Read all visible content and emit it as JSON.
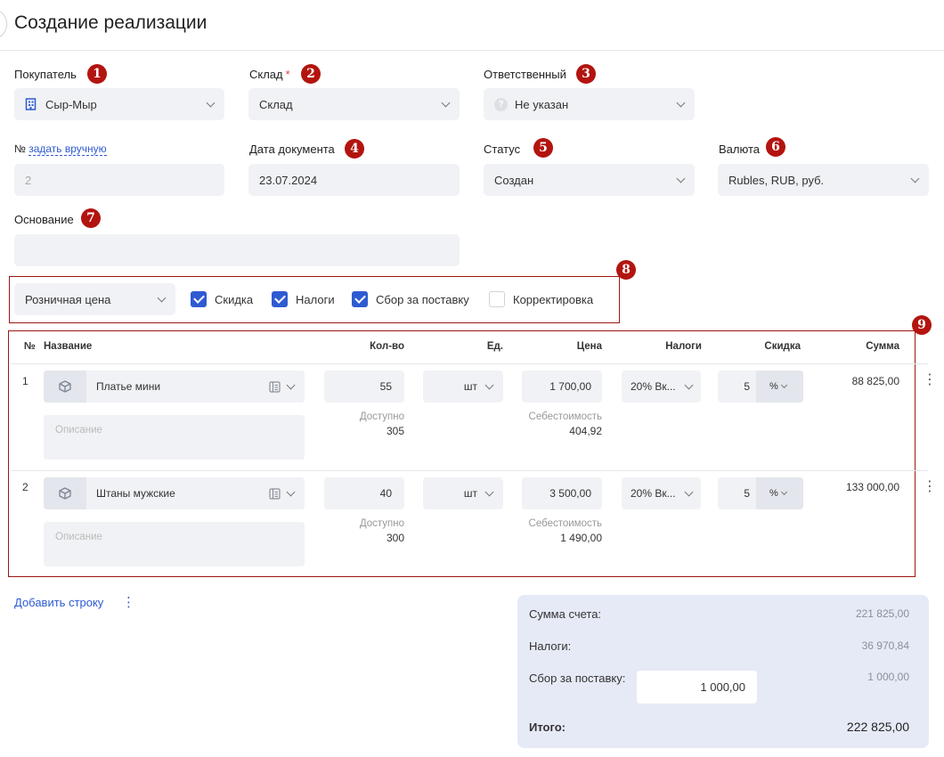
{
  "header": {
    "title": "Создание реализации"
  },
  "form": {
    "buyer": {
      "label": "Покупатель",
      "value": "Сыр-Мыр",
      "badge": "1"
    },
    "warehouse": {
      "label": "Склад",
      "required_mark": "*",
      "value": "Склад",
      "badge": "2"
    },
    "responsible": {
      "label": "Ответственный",
      "value": "Не указан",
      "badge": "3"
    },
    "number": {
      "label": "№",
      "link": "задать вручную",
      "placeholder": "2"
    },
    "doc_date": {
      "label": "Дата документа",
      "value": "23.07.2024",
      "badge": "4"
    },
    "status": {
      "label": "Статус",
      "value": "Создан",
      "badge": "5"
    },
    "currency": {
      "label": "Валюта",
      "value": "Rubles, RUB, руб.",
      "badge": "6"
    },
    "basis": {
      "label": "Основание",
      "value": "",
      "badge": "7"
    }
  },
  "options": {
    "badge": "8",
    "price_type": "Розничная цена",
    "discount": {
      "label": "Скидка",
      "checked": true
    },
    "taxes": {
      "label": "Налоги",
      "checked": true
    },
    "delivery": {
      "label": "Сбор за поставку",
      "checked": true
    },
    "correction": {
      "label": "Корректировка",
      "checked": false
    }
  },
  "table": {
    "badge": "9",
    "columns": [
      "№",
      "Название",
      "Кол-во",
      "Ед.",
      "Цена",
      "Налоги",
      "Скидка",
      "Сумма"
    ],
    "description_placeholder": "Описание",
    "available_label": "Доступно",
    "cost_label": "Себестоимость",
    "rows": [
      {
        "num": "1",
        "name": "Платье мини",
        "qty": "55",
        "available": "305",
        "unit": "шт",
        "price": "1 700,00",
        "cost": "404,92",
        "tax": "20% Вк...",
        "discount": "5",
        "discount_unit": "%",
        "sum": "88 825,00"
      },
      {
        "num": "2",
        "name": "Штаны мужские",
        "qty": "40",
        "available": "300",
        "unit": "шт",
        "price": "3 500,00",
        "cost": "1 490,00",
        "tax": "20% Вк...",
        "discount": "5",
        "discount_unit": "%",
        "sum": "133 000,00"
      }
    ]
  },
  "actions": {
    "add_row": "Добавить строку"
  },
  "totals": {
    "invoice_sum_label": "Сумма счета:",
    "invoice_sum": "221 825,00",
    "taxes_label": "Налоги:",
    "taxes": "36 970,84",
    "delivery_label": "Сбор за поставку:",
    "delivery_input": "1 000,00",
    "delivery": "1 000,00",
    "total_label": "Итого:",
    "total": "222 825,00"
  },
  "colors": {
    "accent": "#2f5bd1",
    "badge": "#b3140f",
    "field_bg": "#f1f2f5",
    "totals_bg": "#e6eaf6"
  }
}
